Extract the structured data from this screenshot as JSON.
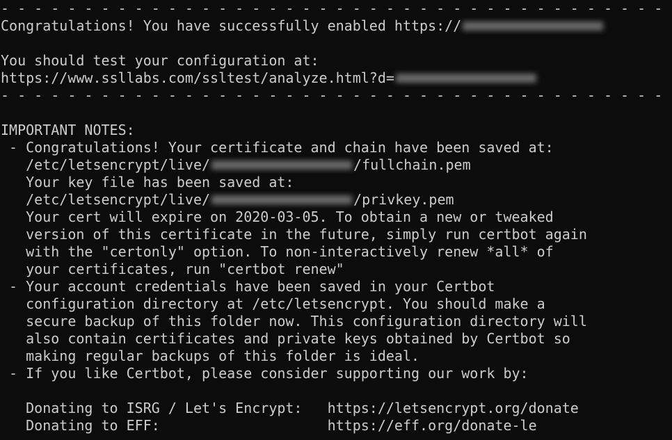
{
  "terminal": {
    "separator": "- - - - - - - - - - - - - - - - - - - - - - - - - - - - - - - - - - - - - - - -",
    "congrats_prefix": "Congratulations! You have successfully enabled https://",
    "test_line": "You should test your configuration at:",
    "ssllabs_prefix": "https://www.ssllabs.com/ssltest/analyze.html?d=",
    "notes_header": "IMPORTANT NOTES:",
    "note1_line1": " - Congratulations! Your certificate and chain have been saved at:",
    "note1_path1_prefix": "   /etc/letsencrypt/live/",
    "note1_path1_suffix": "/fullchain.pem",
    "note1_line3": "   Your key file has been saved at:",
    "note1_path2_prefix": "   /etc/letsencrypt/live/",
    "note1_path2_suffix": "/privkey.pem",
    "note1_line5": "   Your cert will expire on 2020-03-05. To obtain a new or tweaked",
    "note1_line6": "   version of this certificate in the future, simply run certbot again",
    "note1_line7": "   with the \"certonly\" option. To non-interactively renew *all* of",
    "note1_line8": "   your certificates, run \"certbot renew\"",
    "note2_line1": " - Your account credentials have been saved in your Certbot",
    "note2_line2": "   configuration directory at /etc/letsencrypt. You should make a",
    "note2_line3": "   secure backup of this folder now. This configuration directory will",
    "note2_line4": "   also contain certificates and private keys obtained by Certbot so",
    "note2_line5": "   making regular backups of this folder is ideal.",
    "note3_line1": " - If you like Certbot, please consider supporting our work by:",
    "donate_isrg": "   Donating to ISRG / Let's Encrypt:   https://letsencrypt.org/donate",
    "donate_eff": "   Donating to EFF:                    https://eff.org/donate-le"
  }
}
